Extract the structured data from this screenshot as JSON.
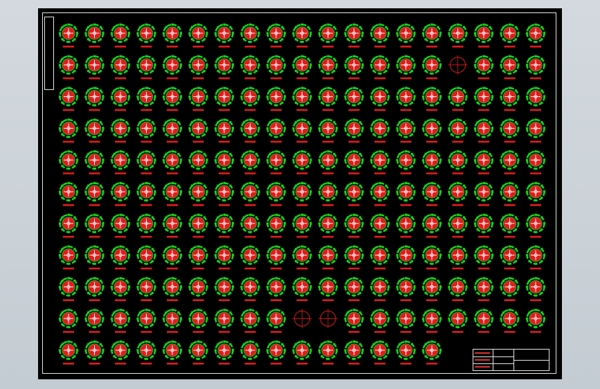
{
  "drawing": {
    "grid": {
      "rows": 11,
      "columns": 19,
      "row_counts": [
        19,
        19,
        19,
        19,
        19,
        19,
        19,
        19,
        19,
        19,
        15
      ],
      "outline_only": [
        [
          1,
          15
        ],
        [
          9,
          9
        ],
        [
          9,
          10
        ]
      ]
    },
    "title_block": {
      "cells": [
        "",
        "",
        "",
        "",
        ""
      ]
    }
  },
  "colors": {
    "background": "#000000",
    "frame": "#e8e8e8",
    "ring": "#19d319",
    "circle_fill": "#e21c1c",
    "cross": "#ffffff",
    "label": "#e21c1c",
    "workspace": "#c9d0d6"
  }
}
